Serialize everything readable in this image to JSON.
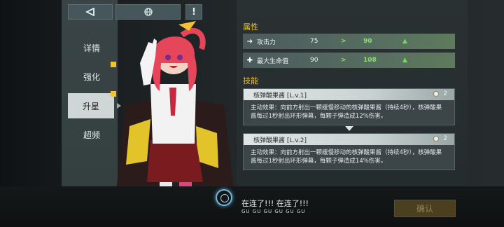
{
  "toolbar": {
    "back_icon": "back-arrow-icon",
    "globe_icon": "globe-icon",
    "info_label": "!"
  },
  "menu": {
    "items": [
      {
        "label": "详情"
      },
      {
        "label": "强化"
      },
      {
        "label": "升星"
      },
      {
        "label": "超频"
      }
    ],
    "active": "升星"
  },
  "attributes": {
    "title": "属性",
    "rows": [
      {
        "icon": "attack-icon",
        "label": "攻击力",
        "from": "75",
        "arrow": ">",
        "to": "90"
      },
      {
        "icon": "health-icon",
        "label": "最大生命值",
        "from": "90",
        "arrow": ">",
        "to": "108"
      }
    ]
  },
  "skills": {
    "title": "技能",
    "cards": [
      {
        "name": "核弹酸果酱 [L.v.1]",
        "cost": "2",
        "desc": "主动效果：向前方射出一颗缓慢移动的核弹酸果酱（持续4秒），核弹酸果酱每过1秒射出环形弹幕，每颗子弹造成12%伤害。"
      },
      {
        "name": "核弹酸果酱 [L.v.2]",
        "cost": "2",
        "desc": "主动效果：向前方射出一颗缓慢移动的核弹酸果酱（持续4秒），核弹酸果酱每过1秒射出环形弹幕，每颗子弹造成14%伤害。"
      }
    ]
  },
  "dialog": {
    "text": "在连了!!! 在连了!!!",
    "sub": "GU GU GU GU GU GU"
  },
  "confirm_label": "确认",
  "colors": {
    "accent": "#f2c230",
    "increase": "#8be06a"
  }
}
